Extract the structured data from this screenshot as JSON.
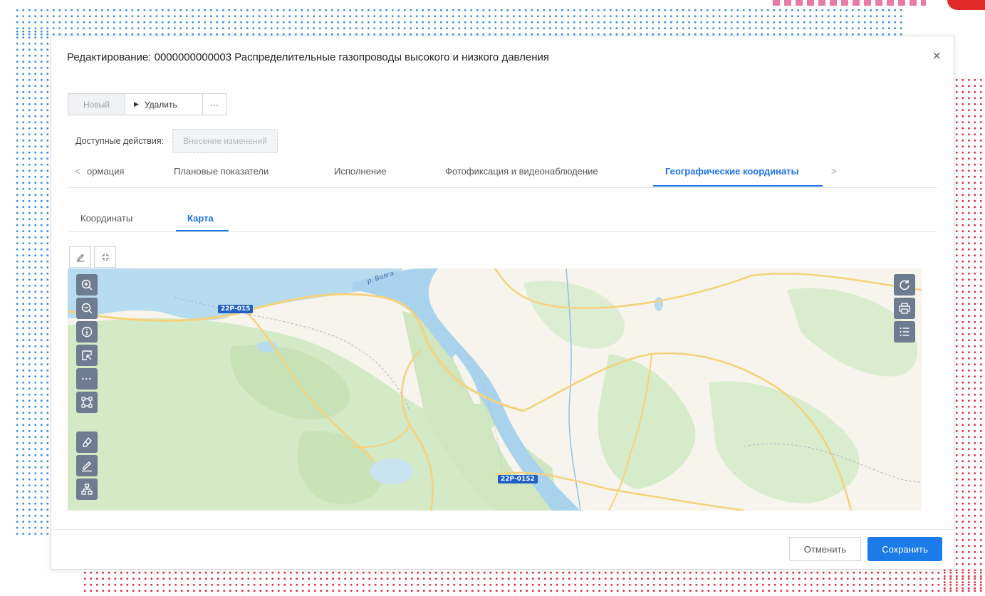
{
  "dialog": {
    "title": "Редактирование: 0000000000003   Распределительные газопроводы высокого и низкого давления",
    "close_label": "×"
  },
  "toolbar": {
    "new_label": "Новый",
    "delete_label": "Удалить",
    "more_label": "···"
  },
  "actions": {
    "label": "Доступные действия:",
    "button_label": "Внесение изменений"
  },
  "tabs": {
    "prev_arrow": "<",
    "next_arrow": ">",
    "items": [
      {
        "label": "ормация"
      },
      {
        "label": "Плановые показатели"
      },
      {
        "label": "Исполнение"
      },
      {
        "label": "Фотофиксация и видеонаблюдение"
      },
      {
        "label": "Географические координаты",
        "active": true
      }
    ]
  },
  "subtabs": {
    "items": [
      {
        "label": "Координаты"
      },
      {
        "label": "Карта",
        "active": true
      }
    ]
  },
  "map": {
    "road_labels": [
      "22P-015",
      "22P-0152"
    ],
    "river_label": "р. Волга",
    "left_controls": [
      "zoom-in-icon",
      "zoom-out-icon",
      "info-icon",
      "select-area-icon",
      "dashed-line-icon",
      "bounding-box-icon",
      "eraser-icon",
      "edit-icon",
      "hierarchy-icon"
    ],
    "right_controls": [
      "refresh-icon",
      "print-icon",
      "list-icon"
    ],
    "colors": {
      "water": "#b7dcf0",
      "forest": "#d2e8c5",
      "land": "#f6f4ec",
      "road": "#f5d27a",
      "controls": "#6e7c91"
    }
  },
  "footer": {
    "cancel_label": "Отменить",
    "save_label": "Сохранить"
  },
  "colors": {
    "accent": "#1c7be8",
    "dots_blue": "#2f8ce6",
    "dots_red": "#e0263a"
  }
}
